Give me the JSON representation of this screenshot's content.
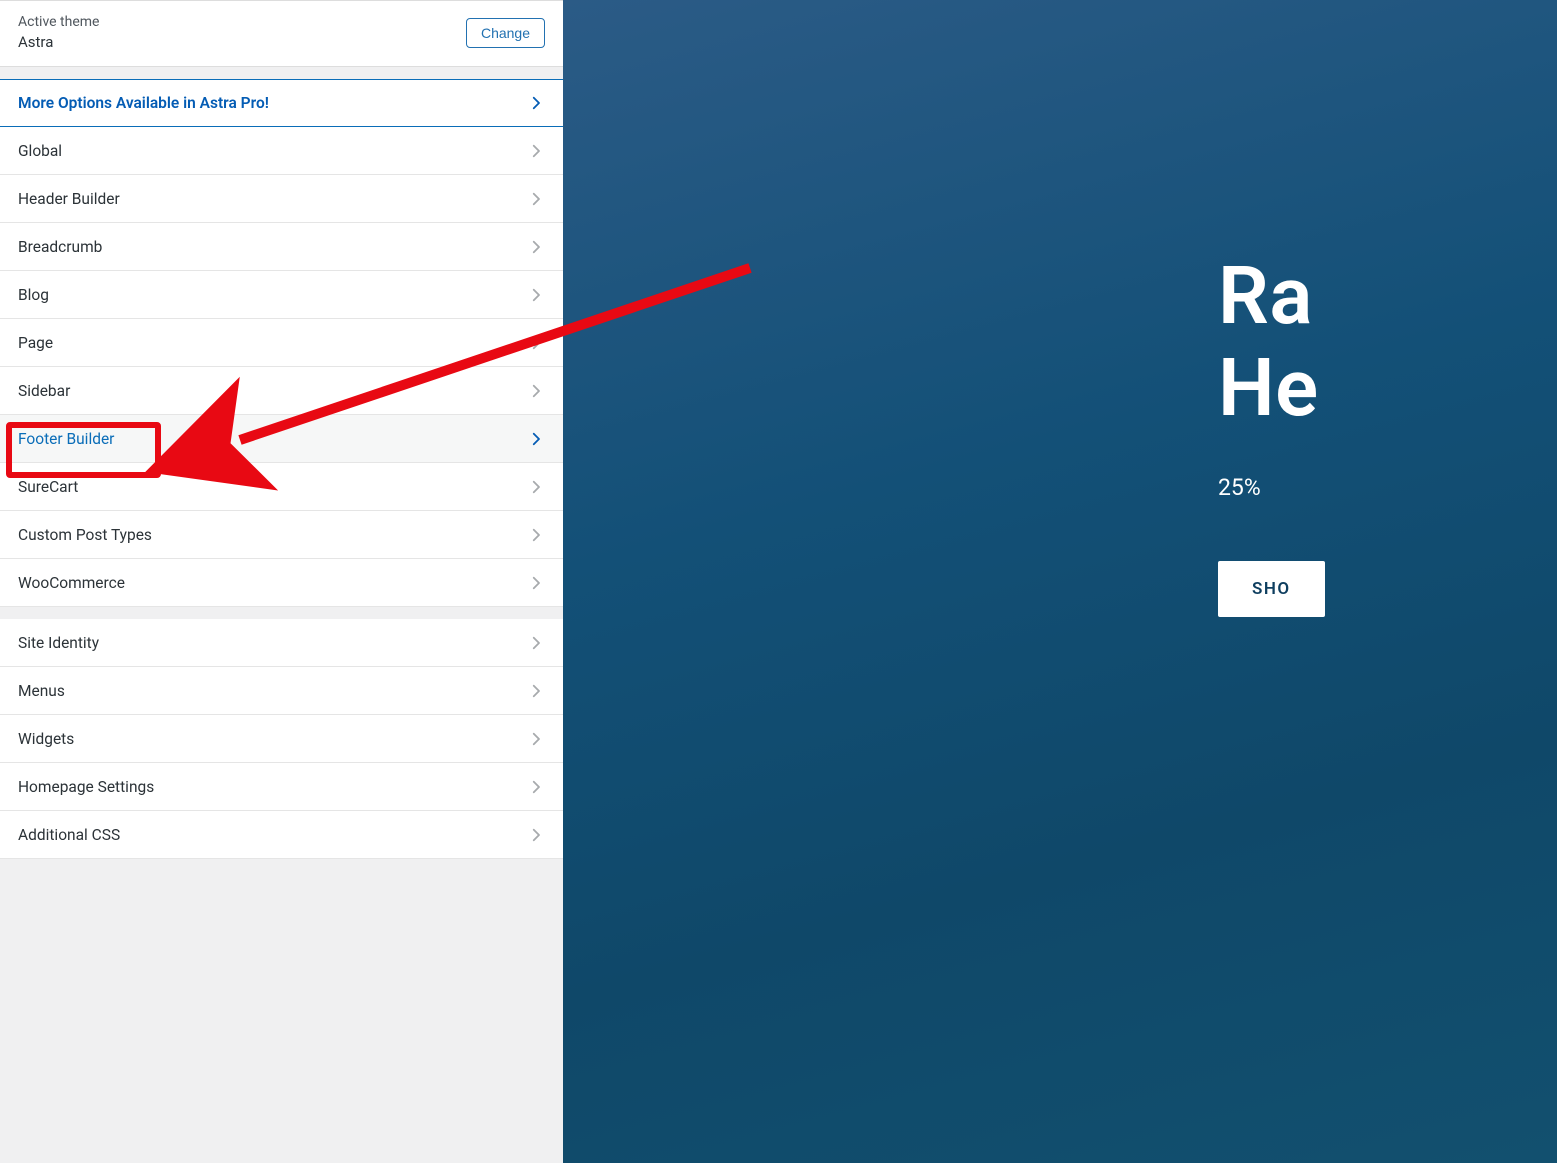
{
  "theme": {
    "label": "Active theme",
    "name": "Astra",
    "change": "Change"
  },
  "panels_primary": [
    {
      "label": "More Options Available in Astra Pro!",
      "slug": "astra-pro-promo",
      "promo": true
    },
    {
      "label": "Global",
      "slug": "global"
    },
    {
      "label": "Header Builder",
      "slug": "header-builder"
    },
    {
      "label": "Breadcrumb",
      "slug": "breadcrumb"
    },
    {
      "label": "Blog",
      "slug": "blog"
    },
    {
      "label": "Page",
      "slug": "page"
    },
    {
      "label": "Sidebar",
      "slug": "sidebar"
    },
    {
      "label": "Footer Builder",
      "slug": "footer-builder",
      "active": true
    },
    {
      "label": "SureCart",
      "slug": "surecart"
    },
    {
      "label": "Custom Post Types",
      "slug": "custom-post-types"
    },
    {
      "label": "WooCommerce",
      "slug": "woocommerce"
    }
  ],
  "panels_secondary": [
    {
      "label": "Site Identity",
      "slug": "site-identity"
    },
    {
      "label": "Menus",
      "slug": "menus"
    },
    {
      "label": "Widgets",
      "slug": "widgets"
    },
    {
      "label": "Homepage Settings",
      "slug": "homepage-settings"
    },
    {
      "label": "Additional CSS",
      "slug": "additional-css"
    }
  ],
  "preview": {
    "heading_line1": "Ra",
    "heading_line2": "He",
    "subtext": "25%",
    "button": "SHO"
  },
  "colors": {
    "accent": "#045cb4",
    "annotation": "#e80913"
  }
}
